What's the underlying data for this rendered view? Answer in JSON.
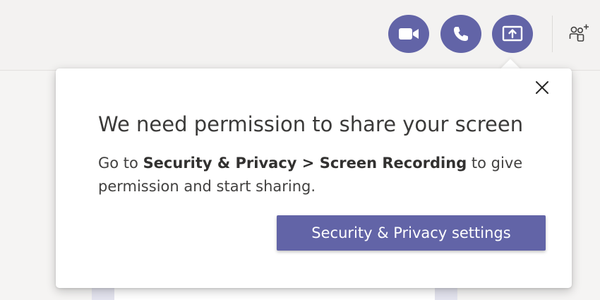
{
  "toolbar": {
    "video_icon": "video-camera-icon",
    "audio_icon": "phone-icon",
    "share_icon": "share-screen-icon",
    "people_icon": "add-people-icon"
  },
  "popup": {
    "title": "We need permission to share your screen",
    "body_prefix": "Go to ",
    "body_bold": "Security & Privacy > Screen Recording",
    "body_suffix": " to give permission and start sharing.",
    "button_label": "Security & Privacy settings",
    "close_icon": "close-icon"
  },
  "colors": {
    "accent": "#6264a7",
    "text": "#3b3a39",
    "background": "#f3f2f1"
  }
}
